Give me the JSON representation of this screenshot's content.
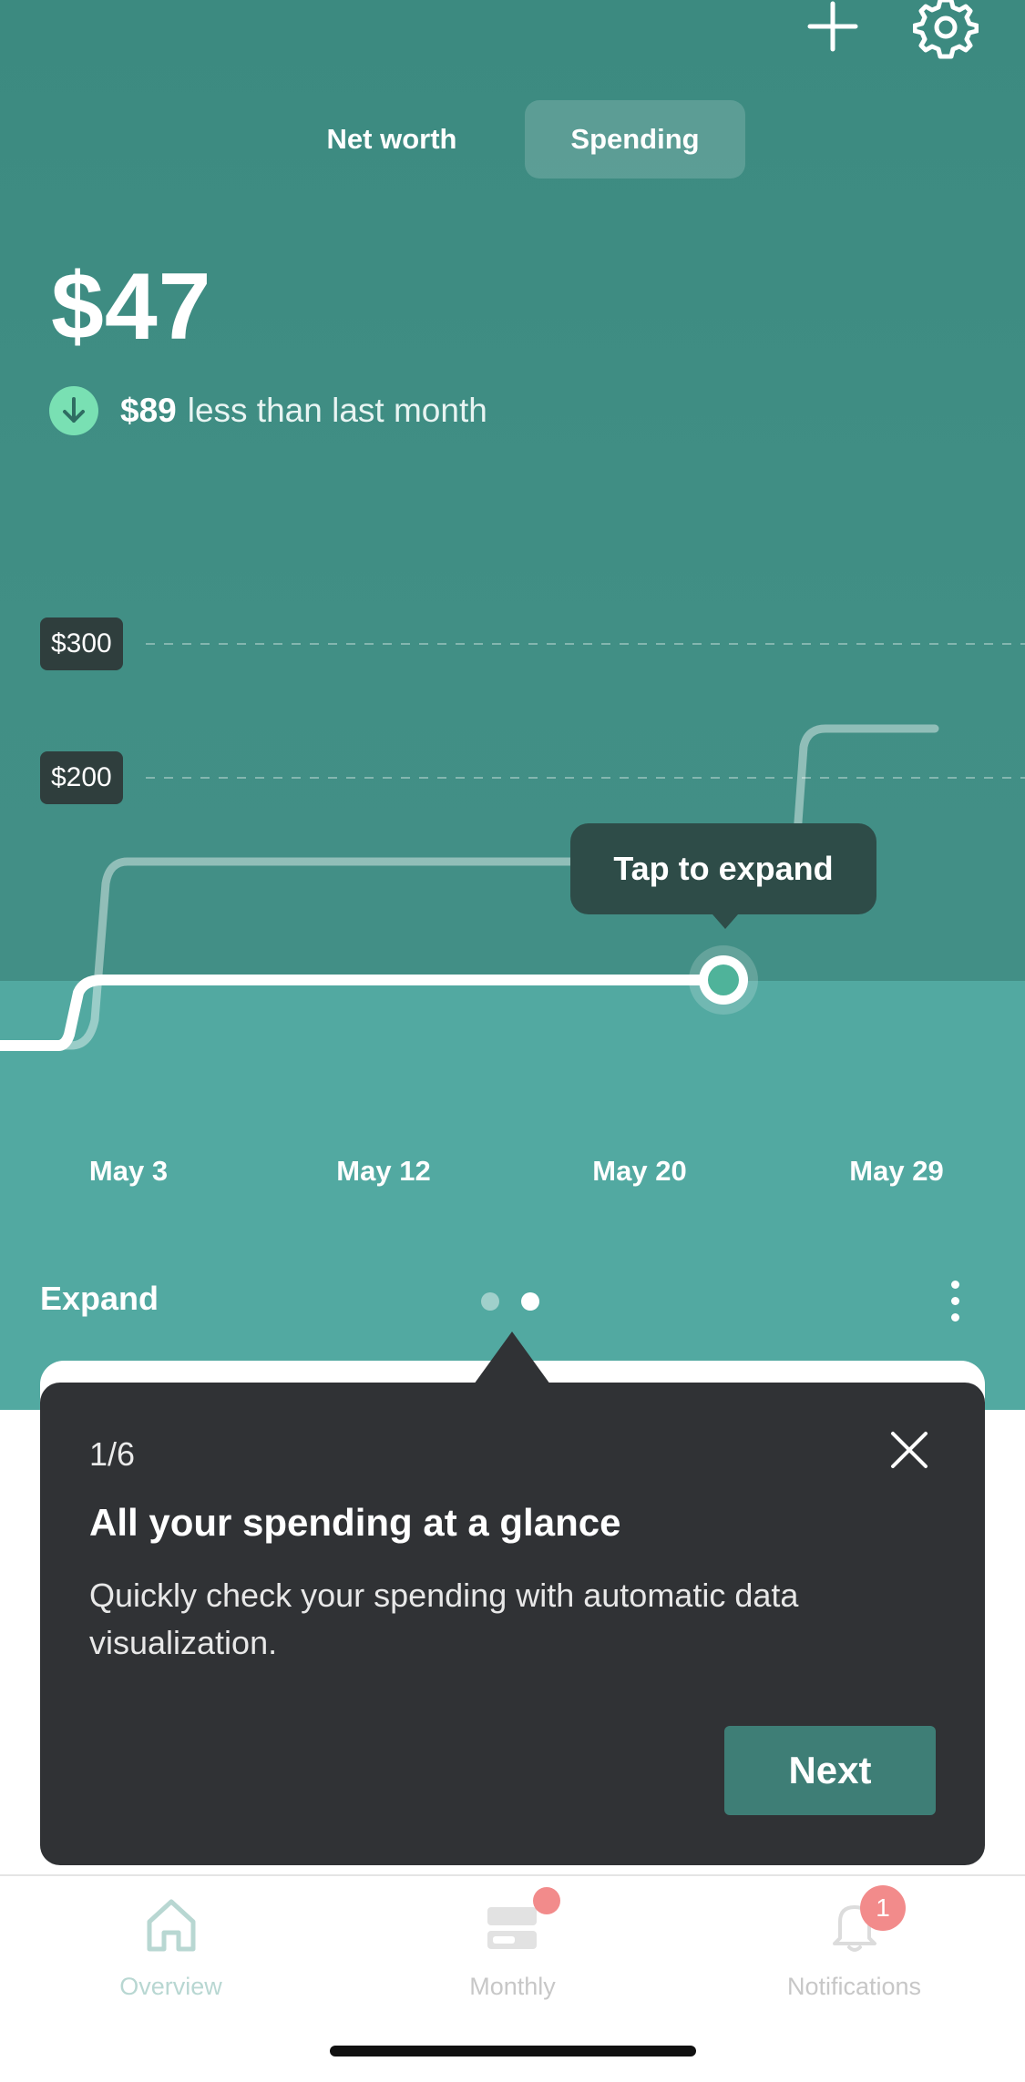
{
  "header": {
    "add_icon": "plus-icon",
    "settings_icon": "gear-icon"
  },
  "segmented": {
    "options": [
      "Net worth",
      "Spending"
    ],
    "selected": "Spending"
  },
  "summary": {
    "amount": "$47",
    "diff_amount": "$89",
    "diff_text": "less than last month",
    "diff_icon": "arrow-down-icon"
  },
  "chart": {
    "y_labels": [
      "$300",
      "$200"
    ],
    "x_labels": [
      "May 3",
      "May 12",
      "May 20",
      "May 29"
    ],
    "tooltip": "Tap to expand"
  },
  "chart_data": {
    "type": "line",
    "x_labels": [
      "May 3",
      "May 12",
      "May 20",
      "May 29"
    ],
    "ytick_labels": [
      "$200",
      "$300"
    ],
    "series": [],
    "annotations": [
      "Tap to expand"
    ]
  },
  "section": {
    "expand_label": "Expand",
    "page_dots": 2,
    "active_dot": 2
  },
  "coachmark": {
    "step": "1/6",
    "title": "All your spending at a glance",
    "body": "Quickly check your spending with automatic data visualization.",
    "next_label": "Next"
  },
  "tabbar": {
    "overview": "Overview",
    "monthly": "Monthly",
    "notifications": "Notifications",
    "notifications_badge": "1"
  },
  "colors": {
    "accent_teal": "#428f86",
    "coach_bg": "#303235",
    "next_button": "#3e7e76",
    "down_badge": "#79e0b3",
    "badge_red": "#f28b8b"
  }
}
